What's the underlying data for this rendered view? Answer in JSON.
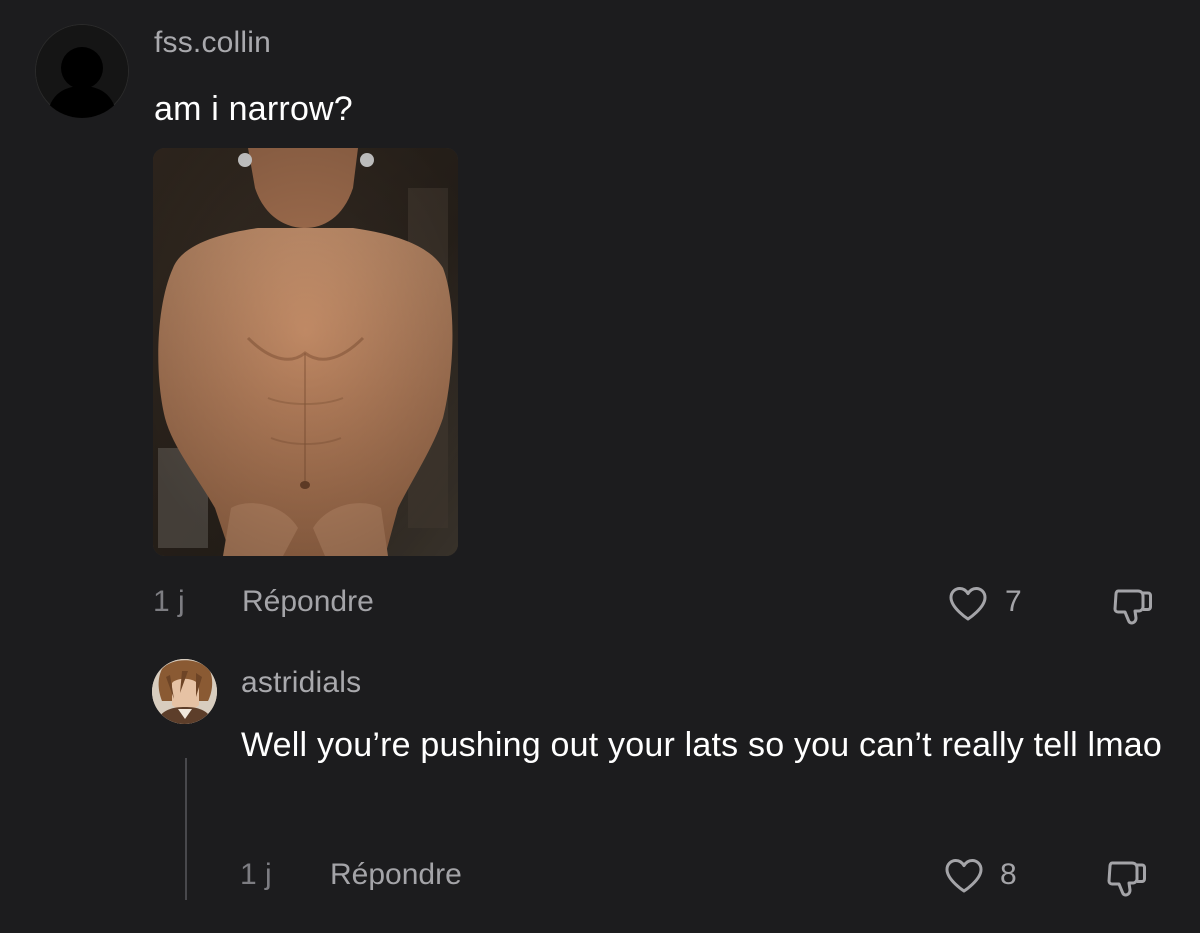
{
  "comment": {
    "username": "fss.collin",
    "text": "am i narrow?",
    "time": "1 j",
    "reply_label": "Répondre",
    "likes": "7",
    "avatar_icon": "default-avatar-icon",
    "photo_icon": "shirtless-torso-photo"
  },
  "reply": {
    "username": "astridials",
    "text": "Well you’re pushing out your lats so you can’t really tell lmao",
    "time": "1 j",
    "reply_label": "Répondre",
    "likes": "8",
    "avatar_icon": "anime-character-avatar"
  },
  "icons": {
    "like": "heart-outline-icon",
    "dislike": "thumbs-down-outline-icon"
  },
  "colors": {
    "background": "#1c1c1e",
    "primary_text": "#ffffff",
    "secondary_text": "#a9a9ad",
    "muted_text": "#7d7d82"
  }
}
